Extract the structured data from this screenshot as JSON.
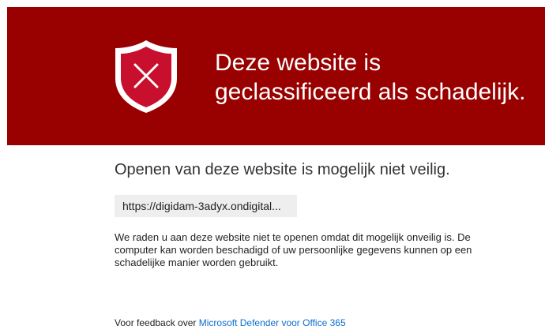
{
  "banner": {
    "title_line1": "Deze website is",
    "title_line2": "geclassificeerd als schadelijk.",
    "background_color": "#990000",
    "icon": "shield-x-icon"
  },
  "subtitle": "Openen van deze website is mogelijk niet veilig.",
  "url": "https://digidam-3adyx.ondigital...",
  "warning_text": "We raden u aan deze website niet te openen omdat dit mogelijk onveilig is. De computer kan worden beschadigd of uw persoonlijke gegevens kunnen op een schadelijke manier worden gebruikt.",
  "feedback": {
    "prefix": "Voor feedback over",
    "link_label": "Microsoft Defender voor Office 365",
    "link_color": "#0a6ecf"
  }
}
